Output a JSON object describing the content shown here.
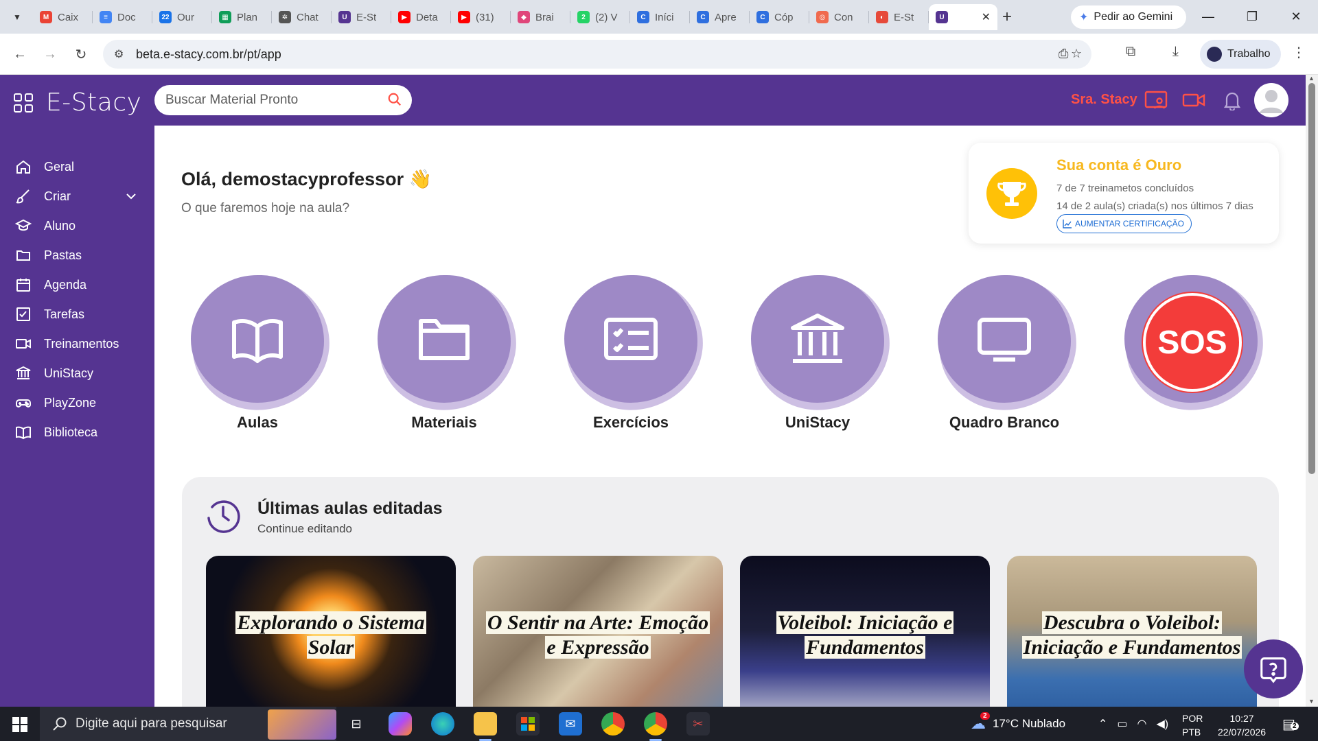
{
  "browser": {
    "tabs": [
      {
        "label": "Caix",
        "color": "#ea4335",
        "glyph": "M"
      },
      {
        "label": "Doc",
        "color": "#4285f4",
        "glyph": "≡"
      },
      {
        "label": "Our",
        "color": "#1a73e8",
        "glyph": "22"
      },
      {
        "label": "Plan",
        "color": "#0f9d58",
        "glyph": "▦"
      },
      {
        "label": "Chat",
        "color": "#555555",
        "glyph": "✲"
      },
      {
        "label": "E-St",
        "color": "#553491",
        "glyph": "U"
      },
      {
        "label": "Deta",
        "color": "#ff0000",
        "glyph": "▶"
      },
      {
        "label": "(31)",
        "color": "#ff0000",
        "glyph": "▶"
      },
      {
        "label": "Brai",
        "color": "#e0467a",
        "glyph": "◆"
      },
      {
        "label": "(2) V",
        "color": "#25d366",
        "glyph": "2"
      },
      {
        "label": "Iníci",
        "color": "#2f6fdf",
        "glyph": "C"
      },
      {
        "label": "Apre",
        "color": "#2f6fdf",
        "glyph": "C"
      },
      {
        "label": "Cóp",
        "color": "#2f6fdf",
        "glyph": "C"
      },
      {
        "label": "Con",
        "color": "#f06a4e",
        "glyph": "◎"
      },
      {
        "label": "E-St",
        "color": "#e64a3a",
        "glyph": "◐"
      },
      {
        "label": "",
        "color": "#553491",
        "glyph": "U"
      }
    ],
    "gemini_label": "Pedir ao Gemini",
    "url": "beta.e-stacy.com.br/pt/app",
    "profile_label": "Trabalho"
  },
  "app": {
    "logo": "E-Stacy",
    "search_placeholder": "Buscar Material Pronto",
    "user_name": "Sra. Stacy",
    "accent": "#553491",
    "alert_color": "#ff5146"
  },
  "sidebar": {
    "items": [
      {
        "label": "Geral",
        "icon": "home-icon"
      },
      {
        "label": "Criar",
        "icon": "brush-icon"
      },
      {
        "label": "Aluno",
        "icon": "graduation-cap-icon"
      },
      {
        "label": "Pastas",
        "icon": "folder-icon"
      },
      {
        "label": "Agenda",
        "icon": "calendar-icon"
      },
      {
        "label": "Tarefas",
        "icon": "checkbox-icon"
      },
      {
        "label": "Treinamentos",
        "icon": "video-icon"
      },
      {
        "label": "UniStacy",
        "icon": "university-icon"
      },
      {
        "label": "PlayZone",
        "icon": "gamepad-icon"
      },
      {
        "label": "Biblioteca",
        "icon": "book-icon"
      }
    ]
  },
  "main": {
    "greeting": "Olá, demostacyprofessor 👋",
    "subtitle": "O que faremos hoje na aula?",
    "certification": {
      "title": "Sua conta é Ouro",
      "line1": "7 de 7 treinametos concluídos",
      "line2": "14 de 2 aula(s) criada(s) nos últimos 7 dias",
      "button": "AUMENTAR CERTIFICAÇÃO"
    },
    "quick_actions": [
      {
        "label": "Aulas",
        "icon": "book-open-icon"
      },
      {
        "label": "Materiais",
        "icon": "folder-icon"
      },
      {
        "label": "Exercícios",
        "icon": "checklist-icon"
      },
      {
        "label": "UniStacy",
        "icon": "university-icon"
      },
      {
        "label": "Quadro Branco",
        "icon": "whiteboard-icon"
      }
    ],
    "sos_label": "SOS",
    "recent": {
      "title": "Últimas aulas editadas",
      "subtitle": "Continue editando",
      "cards": [
        {
          "title": "Explorando o Sistema Solar"
        },
        {
          "title": "O Sentir na Arte: Emoção e Expressão"
        },
        {
          "title": "Voleibol: Iniciação e Fundamentos"
        },
        {
          "title": "Descubra o Voleibol: Iniciação e Fundamentos"
        }
      ]
    }
  },
  "taskbar": {
    "search_text": "Digite aqui para pesquisar",
    "weather": "17°C  Nublado",
    "weather_badge": "2",
    "lang1": "POR",
    "lang2": "PTB",
    "time": "10:27",
    "date": "22/07/2026",
    "notif_count": "2"
  }
}
